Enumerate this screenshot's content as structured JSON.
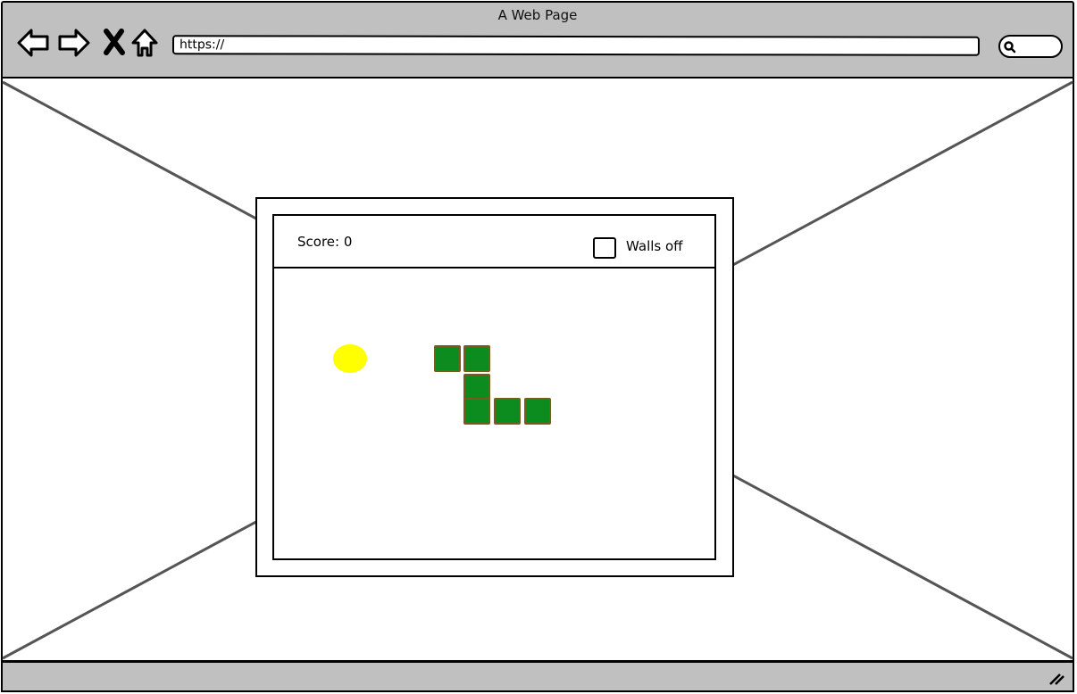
{
  "window": {
    "title": "A Web Page"
  },
  "toolbar": {
    "url": "https://",
    "icons": [
      "back-arrow-icon",
      "forward-arrow-icon",
      "close-x-icon",
      "home-icon",
      "search-icon"
    ]
  },
  "game": {
    "score_label": "Score: 0",
    "walls_label": "Walls off",
    "walls_checked": false,
    "colors": {
      "snake": "#0c8c1e",
      "snake_border": "#7a5a1e",
      "food": "#ffff00"
    }
  }
}
